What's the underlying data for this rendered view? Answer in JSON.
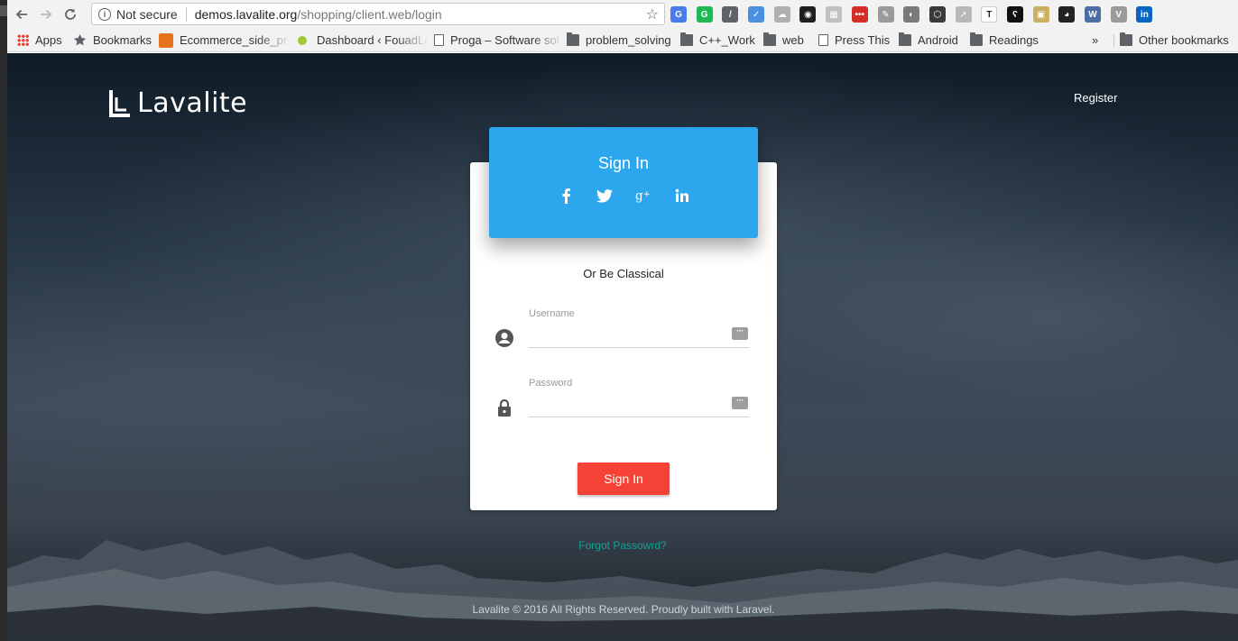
{
  "browser": {
    "security_label": "Not secure",
    "url_host": "demos.lavalite.org",
    "url_path": "/shopping/client.web/login",
    "extensions": [
      {
        "name": "google-translate-icon",
        "color": "#4a7bea",
        "glyph": "G"
      },
      {
        "name": "grammarly-icon",
        "color": "#1db954",
        "glyph": "G"
      },
      {
        "name": "eyedropper-icon",
        "color": "#5f6368",
        "glyph": "/"
      },
      {
        "name": "check-extension-icon",
        "color": "#4a90e2",
        "glyph": "✓"
      },
      {
        "name": "cloud-extension-icon",
        "color": "#b0b0b0",
        "glyph": "☁"
      },
      {
        "name": "color-wheel-icon",
        "color": "#1e1e1e",
        "glyph": "◉"
      },
      {
        "name": "screenshot-extension-icon",
        "color": "#c0c0c0",
        "glyph": "▦"
      },
      {
        "name": "lastpass-icon",
        "color": "#d32d27",
        "glyph": "•••"
      },
      {
        "name": "pen-extension-icon",
        "color": "#9a9a9a",
        "glyph": "✎"
      },
      {
        "name": "camera-extension-icon",
        "color": "#7a7a7a",
        "glyph": "◐"
      },
      {
        "name": "cube-extension-icon",
        "color": "#3a3a3a",
        "glyph": "⬡"
      },
      {
        "name": "arrow-extension-icon",
        "color": "#b8b8b8",
        "glyph": "➚"
      },
      {
        "name": "text-extension-icon",
        "color": "#ffffff",
        "glyph": "T"
      },
      {
        "name": "gnome-extension-icon",
        "color": "#111111",
        "glyph": "ʕ"
      },
      {
        "name": "image-extension-icon",
        "color": "#c8b060",
        "glyph": "▣"
      },
      {
        "name": "panda-extension-icon",
        "color": "#222222",
        "glyph": "◕"
      },
      {
        "name": "w-extension-icon",
        "color": "#4a6fa5",
        "glyph": "W"
      },
      {
        "name": "vue-extension-icon",
        "color": "#9a9a9a",
        "glyph": "V"
      },
      {
        "name": "linkedin-extension-icon",
        "color": "#0a66c2",
        "glyph": "in"
      }
    ]
  },
  "bookmarks": {
    "items": [
      {
        "label": "Apps",
        "icon": "apps-icon"
      },
      {
        "label": "Bookmarks",
        "icon": "star-icon"
      },
      {
        "label": "Ecommerce_side_pr",
        "icon": "orange-site-icon"
      },
      {
        "label": "Dashboard ‹ FouadLe",
        "icon": "lime-site-icon"
      },
      {
        "label": "Proga – Software sol",
        "icon": "page-icon"
      },
      {
        "label": "problem_solving",
        "icon": "folder-icon"
      },
      {
        "label": "C++_Work",
        "icon": "folder-icon"
      },
      {
        "label": "web",
        "icon": "folder-icon"
      },
      {
        "label": "Press This",
        "icon": "page-icon"
      },
      {
        "label": "Android",
        "icon": "folder-icon"
      },
      {
        "label": "Readings",
        "icon": "folder-icon"
      }
    ],
    "overflow": "»",
    "other": "Other bookmarks"
  },
  "page": {
    "brand": "Lavalite",
    "register_link": "Register",
    "card_title": "Sign In",
    "social": [
      {
        "name": "facebook-icon"
      },
      {
        "name": "twitter-icon"
      },
      {
        "name": "google-plus-icon"
      },
      {
        "name": "linkedin-icon"
      }
    ],
    "divider_text": "Or Be Classical",
    "username_label": "Username",
    "username_value": "",
    "password_label": "Password",
    "password_value": "",
    "submit_label": "Sign In",
    "forgot_link": "Forgot Passowrd?",
    "footer": "Lavalite © 2016 All Rights Reserved. Proudly built with Laravel."
  },
  "colors": {
    "header_blue": "#2ca7ee",
    "button_red": "#f44336",
    "link_teal": "#14a094"
  }
}
